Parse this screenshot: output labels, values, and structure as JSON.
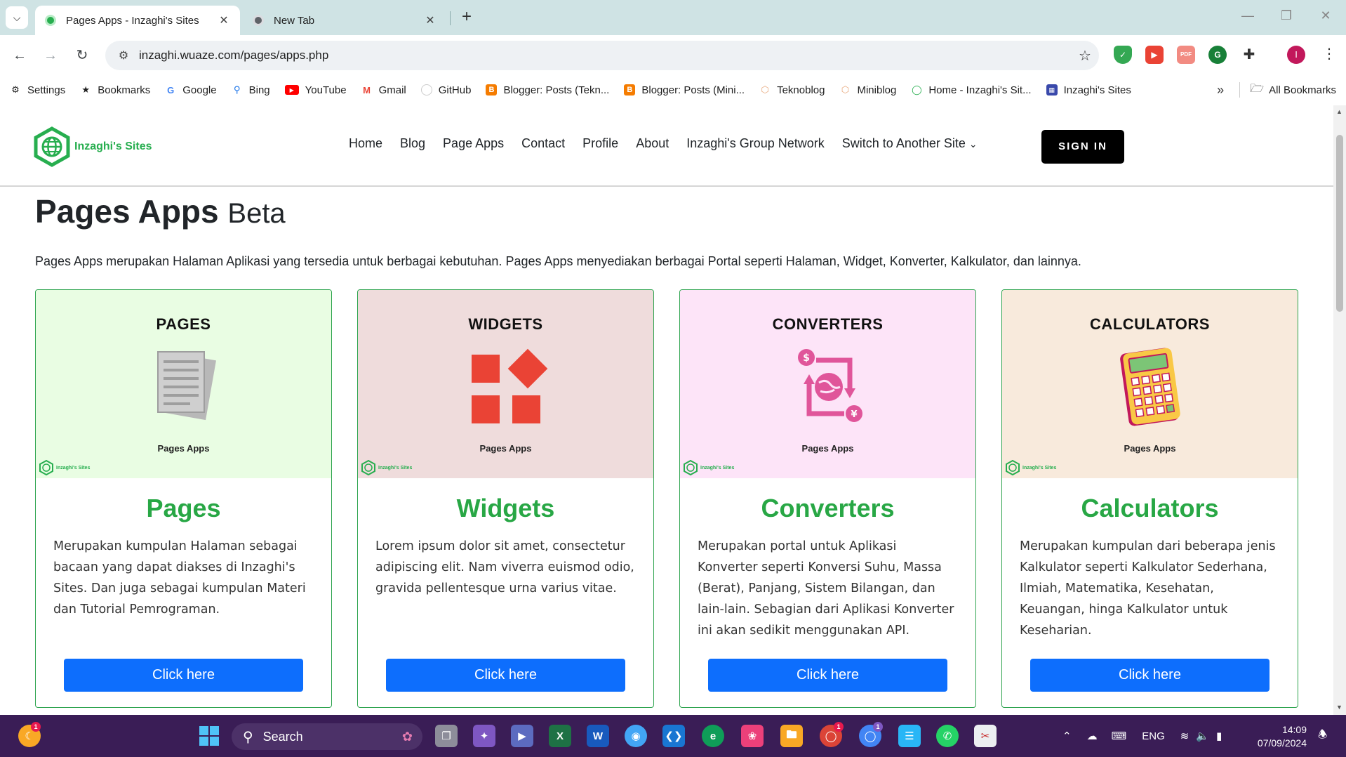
{
  "browser": {
    "tabs": [
      {
        "title": "Pages Apps - Inzaghi's Sites",
        "active": true
      },
      {
        "title": "New Tab",
        "active": false
      }
    ],
    "url": "inzaghi.wuaze.com/pages/apps.php",
    "profile_initial": "I",
    "bookmarks": [
      {
        "label": "Settings",
        "icon": "gear-icon"
      },
      {
        "label": "Bookmarks",
        "icon": "star-icon"
      },
      {
        "label": "Google",
        "icon": "google-icon"
      },
      {
        "label": "Bing",
        "icon": "bing-icon"
      },
      {
        "label": "YouTube",
        "icon": "youtube-icon"
      },
      {
        "label": "Gmail",
        "icon": "gmail-icon"
      },
      {
        "label": "GitHub",
        "icon": "github-icon"
      },
      {
        "label": "Blogger: Posts (Tekn...",
        "icon": "blogger-icon"
      },
      {
        "label": "Blogger: Posts (Mini...",
        "icon": "blogger-icon"
      },
      {
        "label": "Teknoblog",
        "icon": "hexagon-icon"
      },
      {
        "label": "Miniblog",
        "icon": "hexagon-icon"
      },
      {
        "label": "Home - Inzaghi's Sit...",
        "icon": "globe-icon"
      },
      {
        "label": "Inzaghi's Sites",
        "icon": "site-icon"
      }
    ],
    "all_bookmarks_label": "All Bookmarks"
  },
  "site": {
    "logo_text": "Inzaghi's Sites",
    "nav": [
      "Home",
      "Blog",
      "Page Apps",
      "Contact",
      "Profile",
      "About",
      "Inzaghi's Group Network",
      "Switch to Another Site"
    ],
    "sign_in_label": "SIGN IN",
    "colors": {
      "brand_green": "#28a745",
      "button_blue": "#0d6efd"
    }
  },
  "page": {
    "title": "Pages Apps",
    "title_suffix": "Beta",
    "intro": "Pages Apps merupakan Halaman Aplikasi yang tersedia untuk berbagai kebutuhan. Pages Apps menyediakan berbagai Portal seperti Halaman, Widget, Konverter, Kalkulator, dan lainnya.",
    "cards": [
      {
        "category": "PAGES",
        "caption": "Pages Apps",
        "mini_logo": "Inzaghi's Sites",
        "title": "Pages",
        "text": "Merupakan kumpulan Halaman sebagai bacaan yang dapat diakses di Inzaghi's Sites. Dan juga sebagai kumpulan Materi dan Tutorial Pemrograman.",
        "button": "Click here",
        "bg": "#e9fde3"
      },
      {
        "category": "WIDGETS",
        "caption": "Pages Apps",
        "mini_logo": "Inzaghi's Sites",
        "title": "Widgets",
        "text": "Lorem ipsum dolor sit amet, consectetur adipiscing elit. Nam viverra euismod odio, gravida pellentesque urna varius vitae.",
        "button": "Click here",
        "bg": "#efdcdc"
      },
      {
        "category": "CONVERTERS",
        "caption": "Pages Apps",
        "mini_logo": "Inzaghi's Sites",
        "title": "Converters",
        "text": "Merupakan portal untuk Aplikasi Konverter seperti Konversi Suhu, Massa (Berat), Panjang, Sistem Bilangan, dan lain-lain. Sebagian dari Aplikasi Konverter ini akan sedikit menggunakan API.",
        "button": "Click here",
        "bg": "#fde4f8"
      },
      {
        "category": "CALCULATORS",
        "caption": "Pages Apps",
        "mini_logo": "Inzaghi's Sites",
        "title": "Calculators",
        "text": "Merupakan kumpulan dari beberapa jenis Kalkulator seperti Kalkulator Sederhana, Ilmiah, Matematika, Kesehatan, Keuangan, hinga Kalkulator untuk Keseharian.",
        "button": "Click here",
        "bg": "#f8eadc"
      }
    ]
  },
  "taskbar": {
    "search_label": "Search",
    "language": "ENG",
    "time": "14:09",
    "date": "07/09/2024",
    "notification_count": "1"
  }
}
